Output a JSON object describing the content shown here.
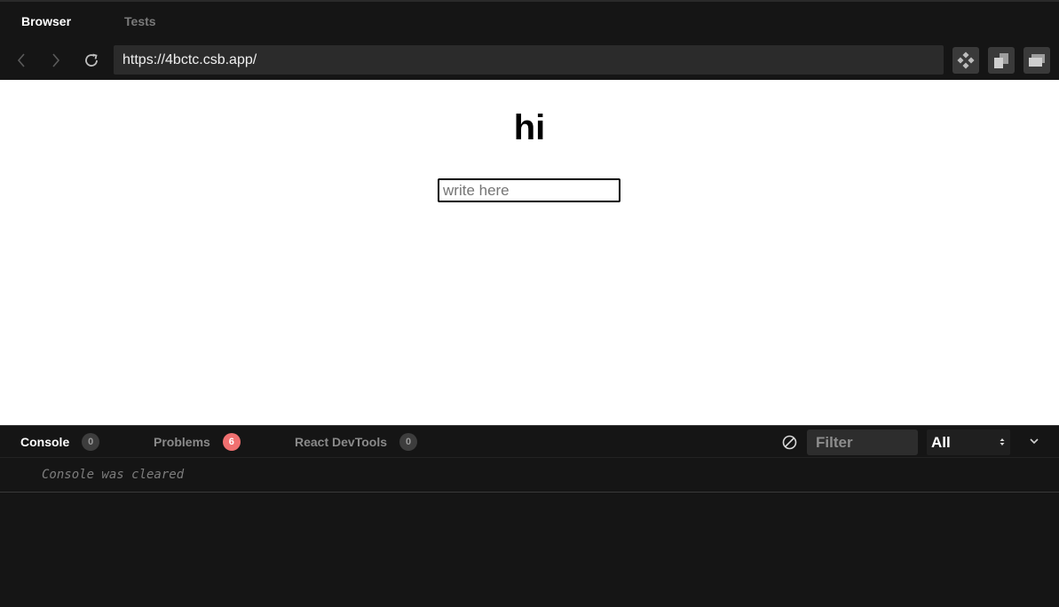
{
  "top_tabs": {
    "browser": "Browser",
    "tests": "Tests"
  },
  "navbar": {
    "url": "https://4bctc.csb.app/",
    "back_icon": "chevron-left-icon",
    "forward_icon": "chevron-right-icon",
    "refresh_icon": "refresh-icon",
    "tools": [
      "devtools-icon",
      "open-new-window-icon",
      "open-preview-window-icon"
    ]
  },
  "preview": {
    "heading": "hi",
    "input_placeholder": "write here",
    "input_value": ""
  },
  "console": {
    "tabs": [
      {
        "label": "Console",
        "count": "0",
        "active": true
      },
      {
        "label": "Problems",
        "count": "6",
        "active": false
      },
      {
        "label": "React DevTools",
        "count": "0",
        "active": false
      }
    ],
    "filter_placeholder": "Filter",
    "level": "All",
    "messages": [
      "Console was cleared"
    ]
  },
  "colors": {
    "background": "#151515",
    "problems_badge": "#f07070",
    "url_bar": "#2b2b2b"
  }
}
